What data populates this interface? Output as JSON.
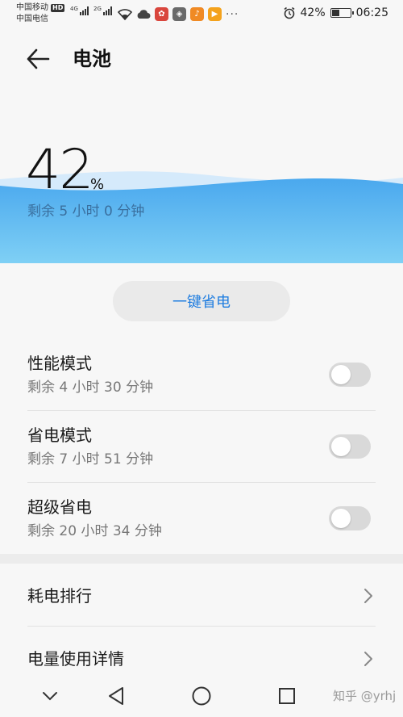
{
  "status_bar": {
    "carrier_1": "中国移动",
    "hd_badge": "HD",
    "carrier_2": "中国电信",
    "signal_1_type": "4G",
    "signal_2_type": "2G",
    "battery_percent": "42%",
    "battery_level": 0.42,
    "time": "06:25"
  },
  "header": {
    "title": "电池"
  },
  "battery": {
    "percent_value": "42",
    "percent_sign": "%",
    "remaining": "剩余 5 小时 0 分钟"
  },
  "actions": {
    "one_key_save": "一键省电"
  },
  "modes": [
    {
      "title": "性能模式",
      "remaining": "剩余 4 小时 30 分钟",
      "enabled": false
    },
    {
      "title": "省电模式",
      "remaining": "剩余 7 小时 51 分钟",
      "enabled": false
    },
    {
      "title": "超级省电",
      "remaining": "剩余 20 小时 34 分钟",
      "enabled": false
    }
  ],
  "links": [
    {
      "label": "耗电排行"
    },
    {
      "label": "电量使用详情"
    }
  ],
  "watermark": "知乎 @yrhj",
  "colors": {
    "accent": "#1f7de0",
    "wave_top": "#4aa8ee",
    "wave_bottom": "#7fd0f5"
  }
}
